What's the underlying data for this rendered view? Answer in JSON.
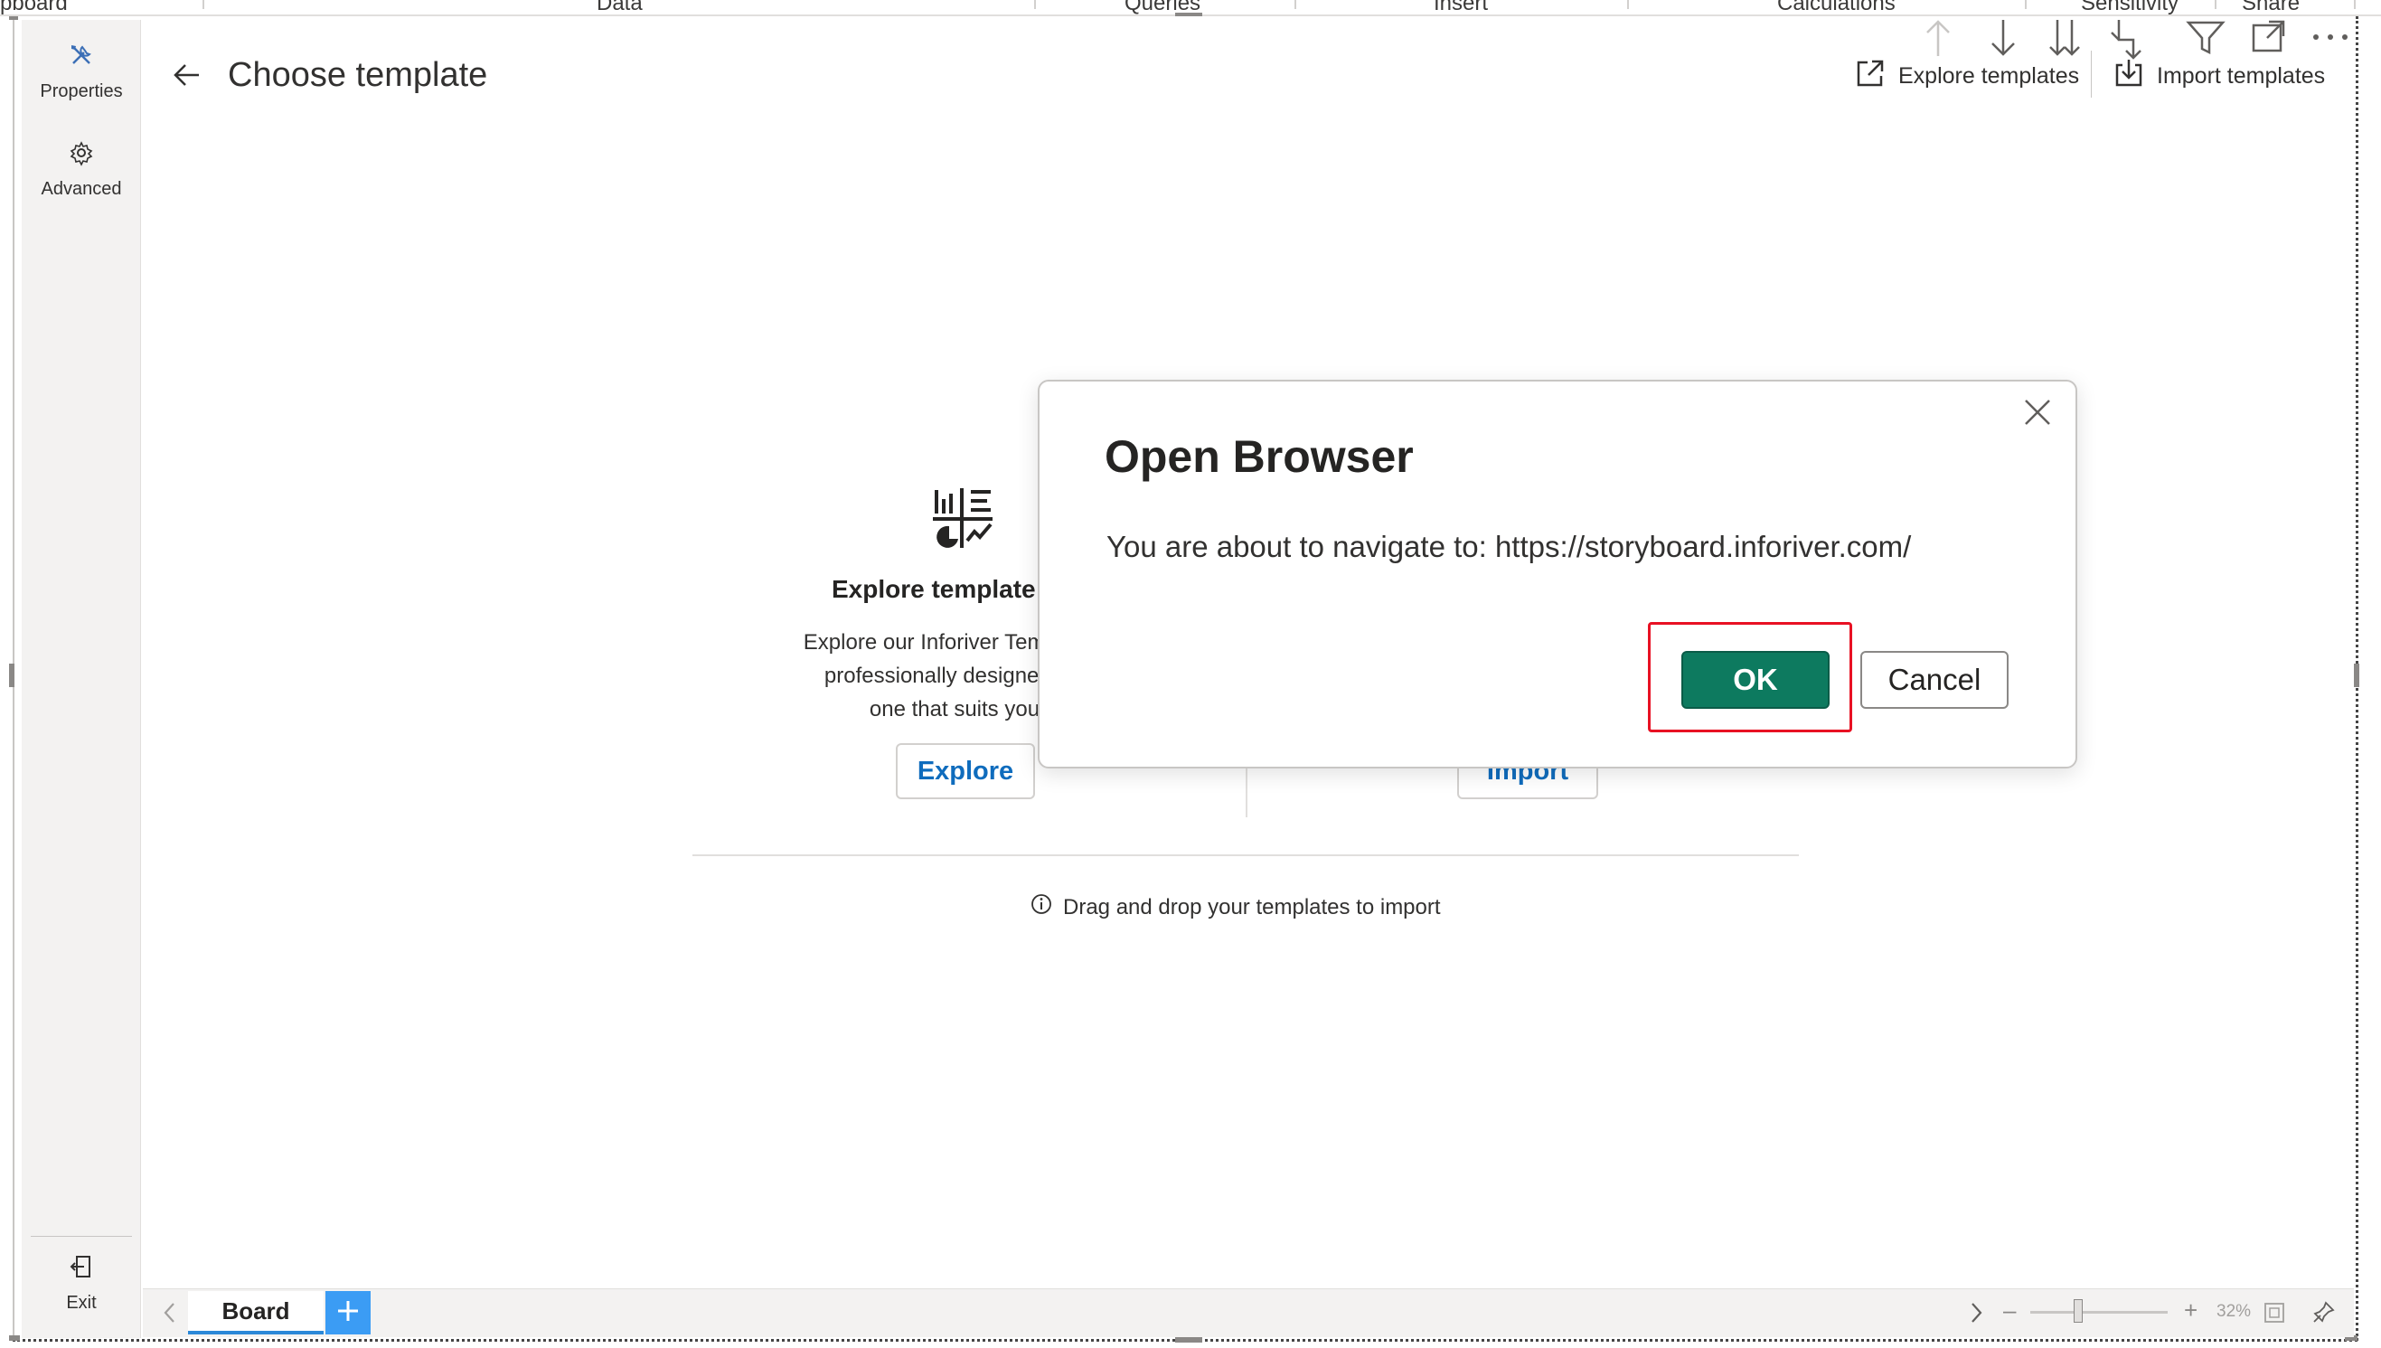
{
  "ribbon": {
    "tabs": [
      "pboard",
      "Data",
      "Queries",
      "Insert",
      "Calculations",
      "Sensitivity",
      "Share"
    ]
  },
  "rail": {
    "properties_label": "Properties",
    "advanced_label": "Advanced",
    "exit_label": "Exit"
  },
  "header": {
    "title": "Choose template",
    "explore_templates_label": "Explore templates",
    "import_templates_label": "Import templates"
  },
  "explore_card": {
    "title": "Explore template",
    "desc_lines": [
      "Explore our Inforiver Template Sto",
      "professionally designed templ",
      "one that suits your n"
    ],
    "button_label": "Explore"
  },
  "import_card": {
    "button_label": "Import"
  },
  "drag_hint": "Drag and drop your templates to import",
  "dialog": {
    "title": "Open Browser",
    "message": "You are about to navigate to: https://storyboard.inforiver.com/",
    "ok_label": "OK",
    "cancel_label": "Cancel"
  },
  "bottom": {
    "page_tab": "Board",
    "zoom_percent": "32%"
  },
  "colors": {
    "accent_green": "#0d7a5f",
    "link_blue": "#0f6cbd",
    "tab_add_blue": "#3b9cf4",
    "highlight_red": "#e81123"
  },
  "icons": [
    "tools-icon",
    "gear-icon",
    "exit-icon",
    "back-arrow-icon",
    "external-link-icon",
    "import-icon",
    "template-gallery-icon",
    "info-icon",
    "close-icon",
    "plus-icon",
    "chevron-left-icon",
    "chevron-right-icon",
    "filter-icon",
    "focus-mode-icon",
    "more-options-icon"
  ]
}
